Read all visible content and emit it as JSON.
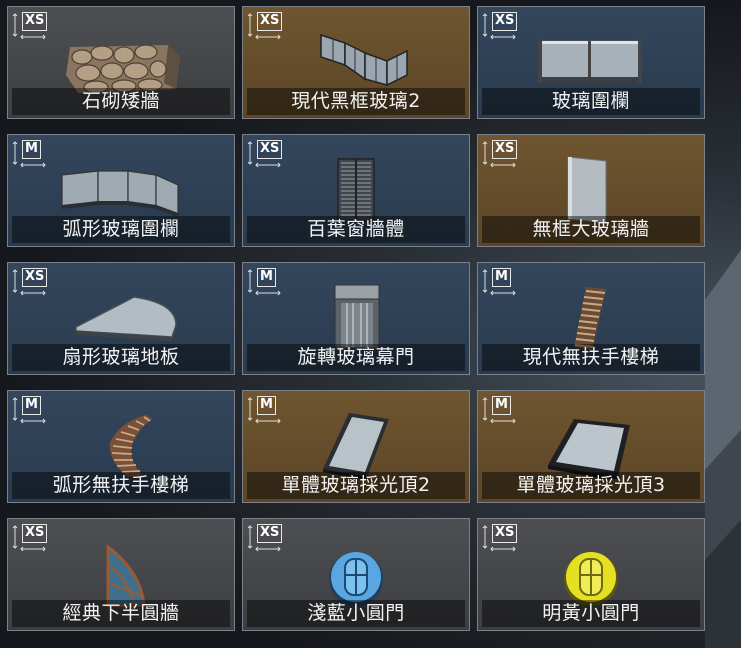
{
  "colors": {
    "gray": "#45474a",
    "blue": "#2f4256",
    "brown": "#654e2b",
    "border": "#7c8088"
  },
  "items": [
    {
      "name": "石砌矮牆",
      "size": "XS",
      "theme": "gray",
      "icon": "stone-wall-icon"
    },
    {
      "name": "現代黑框玻璃2",
      "size": "XS",
      "theme": "brown",
      "icon": "folding-glass-wall-icon"
    },
    {
      "name": "玻璃圍欄",
      "size": "XS",
      "theme": "blue",
      "icon": "glass-fence-icon"
    },
    {
      "name": "弧形玻璃圍欄",
      "size": "M",
      "theme": "blue",
      "icon": "curved-glass-fence-icon"
    },
    {
      "name": "百葉窗牆體",
      "size": "XS",
      "theme": "blue",
      "icon": "louver-wall-icon"
    },
    {
      "name": "無框大玻璃牆",
      "size": "XS",
      "theme": "brown",
      "icon": "frameless-glass-wall-icon"
    },
    {
      "name": "扇形玻璃地板",
      "size": "XS",
      "theme": "blue",
      "icon": "fan-glass-floor-icon"
    },
    {
      "name": "旋轉玻璃幕門",
      "size": "M",
      "theme": "blue",
      "icon": "revolving-door-icon"
    },
    {
      "name": "現代無扶手樓梯",
      "size": "M",
      "theme": "blue",
      "icon": "straight-stairs-icon"
    },
    {
      "name": "弧形無扶手樓梯",
      "size": "M",
      "theme": "blue",
      "icon": "spiral-stairs-icon"
    },
    {
      "name": "單體玻璃採光頂2",
      "size": "M",
      "theme": "brown",
      "icon": "skylight-icon"
    },
    {
      "name": "單體玻璃採光頂3",
      "size": "M",
      "theme": "brown",
      "icon": "skylight-dark-icon"
    },
    {
      "name": "經典下半圓牆",
      "size": "XS",
      "theme": "gray",
      "icon": "half-round-wall-icon"
    },
    {
      "name": "淺藍小圓門",
      "size": "XS",
      "theme": "gray",
      "icon": "light-blue-round-door-icon"
    },
    {
      "name": "明黃小圓門",
      "size": "XS",
      "theme": "gray",
      "icon": "yellow-round-door-icon"
    }
  ]
}
